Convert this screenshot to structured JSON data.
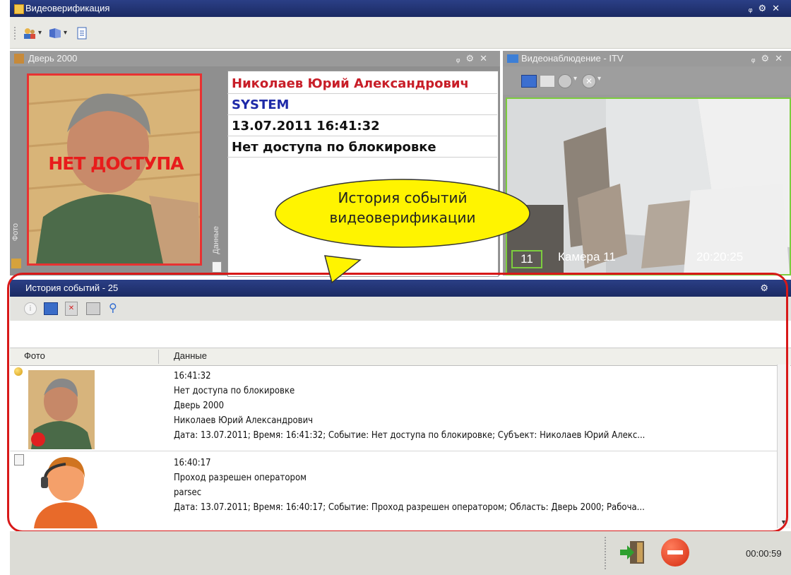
{
  "window": {
    "title": "Видеоверификация"
  },
  "door_panel": {
    "title": "Дверь 2000",
    "photo_tab": "Фото",
    "data_tab": "Данные",
    "overlay": "НЕТ ДОСТУПА",
    "info": {
      "name": "Николаев Юрий Александрович",
      "operator": "SYSTEM",
      "datetime": "13.07.2011 16:41:32",
      "event": "Нет доступа по блокировке"
    }
  },
  "video_panel": {
    "title": "Видеонаблюдение - ITV",
    "camera_number": "11",
    "camera_name": "Камера 11",
    "time": "20:20:25"
  },
  "callout": {
    "line1": "История событий",
    "line2": "видеоверификации"
  },
  "history": {
    "title": "История событий - 25",
    "columns": [
      "Фото",
      "Данные"
    ],
    "rows": [
      {
        "time": "16:41:32",
        "event": "Нет доступа по блокировке",
        "door": "Дверь 2000",
        "person": "Николаев Юрий Александрович",
        "details": "Дата: 13.07.2011; Время: 16:41:32; Событие: Нет доступа по блокировке; Субъект: Николаев Юрий Алекс..."
      },
      {
        "time": "16:40:17",
        "event": "Проход разрешен оператором",
        "door": "parsec",
        "details": "Дата: 13.07.2011; Время: 16:40:17; Событие: Проход разрешен оператором; Область: Дверь 2000; Рабоча..."
      }
    ]
  },
  "status": {
    "timer": "00:00:59"
  },
  "colors": {
    "accent_red": "#d81919",
    "title_blue": "#1e2d6e",
    "name_red": "#c81e28",
    "system_blue": "#1e2aa8",
    "callout_yellow": "#fff400"
  }
}
